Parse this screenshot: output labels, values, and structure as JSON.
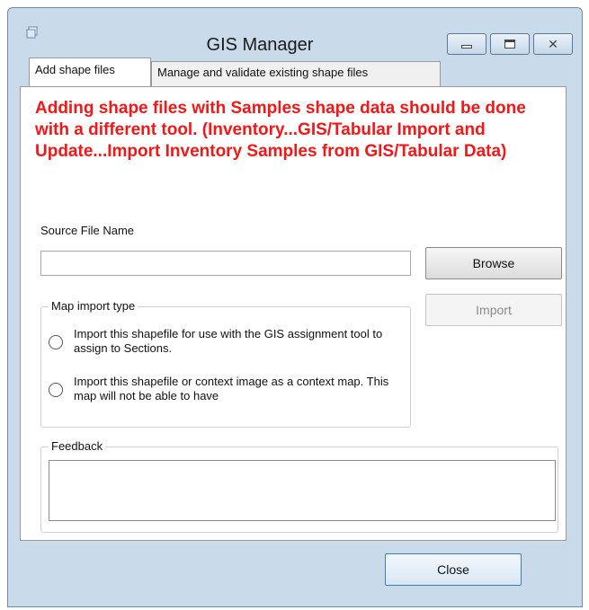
{
  "window": {
    "title": "GIS Manager"
  },
  "tabs": [
    {
      "label": "Add shape files",
      "active": true
    },
    {
      "label": "Manage and validate existing shape files",
      "active": false
    }
  ],
  "warning": "Adding shape files with Samples shape data should be done with a different tool. (Inventory...GIS/Tabular Import and Update...Import Inventory Samples from GIS/Tabular Data)",
  "source": {
    "label": "Source File Name",
    "value": "",
    "browse_label": "Browse"
  },
  "import_button": {
    "label": "Import",
    "enabled": false
  },
  "map_import": {
    "title": "Map import type",
    "options": [
      {
        "label": "Import this shapefile for use with the GIS assignment tool to assign to Sections.",
        "checked": false
      },
      {
        "label": "Import this shapefile or context image as a context map.  This map will not be able to have",
        "checked": false
      }
    ]
  },
  "feedback": {
    "title": "Feedback",
    "value": ""
  },
  "close_label": "Close",
  "colors": {
    "warning": "#f01818",
    "frame": "#c9daea",
    "panel": "#ffffff"
  }
}
